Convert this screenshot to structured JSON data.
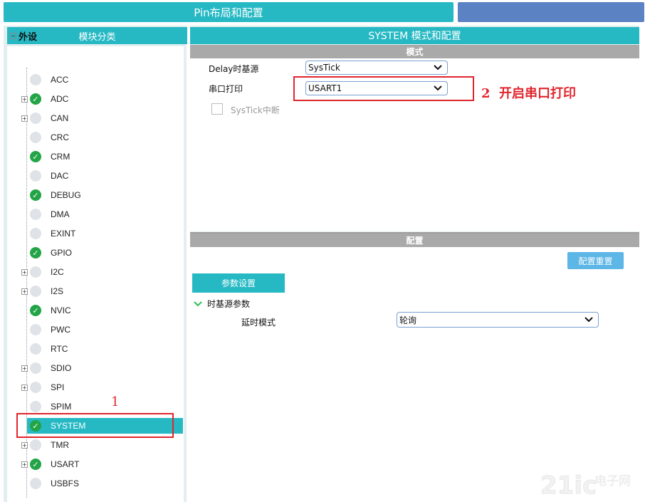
{
  "tabs": {
    "pin_layout": "Pin布局和配置"
  },
  "left_panel": {
    "title": "模块分类",
    "root_label": "外设",
    "items": [
      {
        "label": "ACC",
        "expandable": false,
        "enabled": false
      },
      {
        "label": "ADC",
        "expandable": true,
        "enabled": true
      },
      {
        "label": "CAN",
        "expandable": true,
        "enabled": false
      },
      {
        "label": "CRC",
        "expandable": false,
        "enabled": false
      },
      {
        "label": "CRM",
        "expandable": false,
        "enabled": true
      },
      {
        "label": "DAC",
        "expandable": false,
        "enabled": false
      },
      {
        "label": "DEBUG",
        "expandable": false,
        "enabled": true
      },
      {
        "label": "DMA",
        "expandable": false,
        "enabled": false
      },
      {
        "label": "EXINT",
        "expandable": false,
        "enabled": false
      },
      {
        "label": "GPIO",
        "expandable": false,
        "enabled": true
      },
      {
        "label": "I2C",
        "expandable": true,
        "enabled": false
      },
      {
        "label": "I2S",
        "expandable": true,
        "enabled": false
      },
      {
        "label": "NVIC",
        "expandable": false,
        "enabled": true
      },
      {
        "label": "PWC",
        "expandable": false,
        "enabled": false
      },
      {
        "label": "RTC",
        "expandable": false,
        "enabled": false
      },
      {
        "label": "SDIO",
        "expandable": true,
        "enabled": false
      },
      {
        "label": "SPI",
        "expandable": true,
        "enabled": false
      },
      {
        "label": "SPIM",
        "expandable": false,
        "enabled": false
      },
      {
        "label": "SYSTEM",
        "expandable": false,
        "enabled": true,
        "selected": true
      },
      {
        "label": "TMR",
        "expandable": true,
        "enabled": false
      },
      {
        "label": "USART",
        "expandable": true,
        "enabled": true
      },
      {
        "label": "USBFS",
        "expandable": false,
        "enabled": false
      }
    ]
  },
  "right_panel": {
    "title": "SYSTEM 模式和配置",
    "mode_section": "模式",
    "delay_label": "Delay时基源",
    "delay_value": "SysTick",
    "uart_label": "串口打印",
    "uart_value": "USART1",
    "systick_irq_label": "SysTick中断",
    "config_section": "配置",
    "reset_button": "配置重置",
    "param_tab": "参数设置",
    "group_label": "时基源参数",
    "delay_mode_label": "延时模式",
    "delay_mode_value": "轮询"
  },
  "annotations": {
    "step1": "1",
    "step2": "2  开启串口打印"
  },
  "colors": {
    "accent": "#26b9c4",
    "ok": "#22a447",
    "annotation": "#e0262e"
  },
  "watermark": "21ic电子网"
}
